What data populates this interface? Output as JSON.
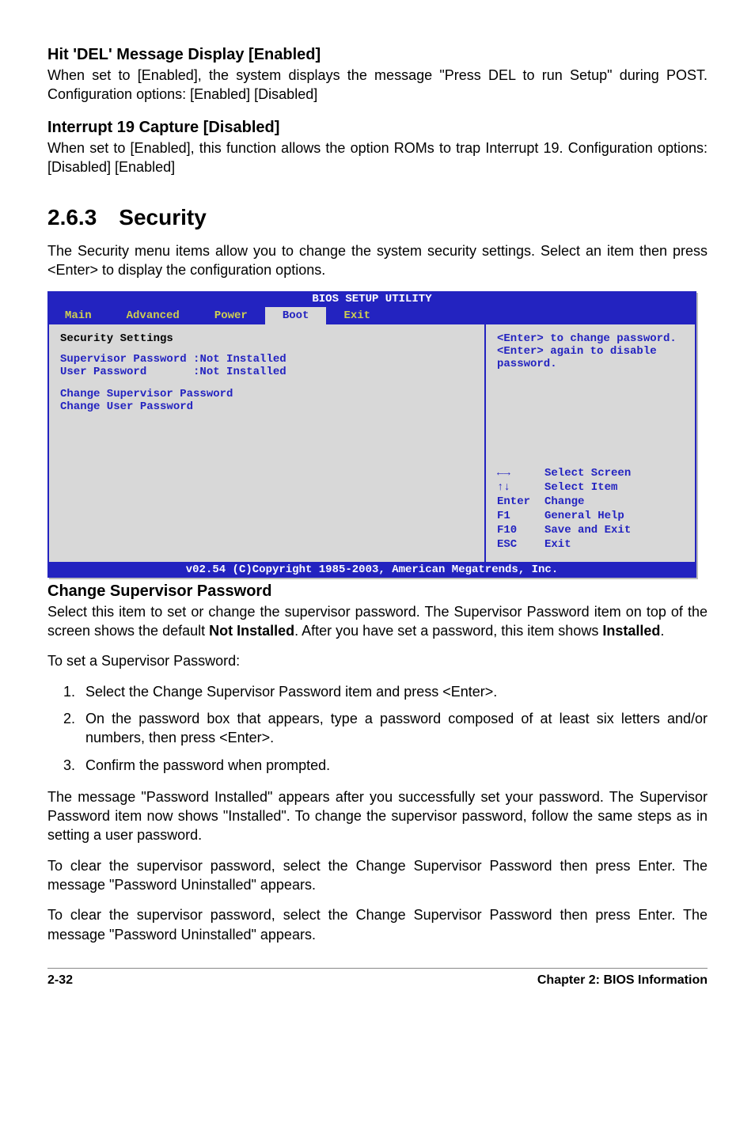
{
  "sections": {
    "hitdel": {
      "title": "Hit 'DEL' Message Display [Enabled]",
      "body": "When set to [Enabled], the system displays the message \"Press DEL to run Setup\" during POST. Configuration options: [Enabled] [Disabled]"
    },
    "int19": {
      "title": "Interrupt 19 Capture [Disabled]",
      "body": "When set to [Enabled], this function allows the option ROMs to trap Interrupt 19. Configuration options: [Disabled] [Enabled]"
    },
    "security": {
      "number_title": "2.6.3 Security",
      "intro": "The Security menu items allow you to change the system security settings. Select an item then press <Enter> to display the configuration options."
    },
    "csp": {
      "title": "Change Supervisor Password",
      "body_pre": "Select this item to set or change the supervisor password. The Supervisor Password item on top of the screen shows the default ",
      "not_installed": "Not Installed",
      "body_mid": ". After you have set a password, this item shows ",
      "installed": "Installed",
      "body_post": ".",
      "setline": "To set a Supervisor Password:",
      "steps": [
        "Select the Change Supervisor Password item and press <Enter>.",
        "On the password box that appears, type a password composed of at least six letters and/or numbers, then press <Enter>.",
        "Confirm the password when prompted."
      ],
      "p1": "The message \"Password Installed\" appears after you successfully set your password. The Supervisor Password item now shows \"Installed\". To change the supervisor password, follow the same steps as in setting a user password.",
      "p2": "To clear the supervisor password, select the Change Supervisor Password then press Enter. The message \"Password Uninstalled\" appears.",
      "p3": "To clear the supervisor password, select the Change Supervisor Password then press Enter. The message \"Password Uninstalled\" appears."
    }
  },
  "bios": {
    "title": "BIOS SETUP UTILITY",
    "tabs": [
      "Main",
      "Advanced",
      "Power",
      "Boot",
      "Exit"
    ],
    "left": {
      "heading": "Security Settings",
      "row1_label": "Supervisor Password",
      "row1_val": ":Not Installed",
      "row2_label": "User Password",
      "row2_val": ":Not Installed",
      "opt1": "Change Supervisor Password",
      "opt2": "Change User Password"
    },
    "right": {
      "help1": "<Enter> to change password.",
      "help2": "<Enter> again to disable password.",
      "nav": [
        {
          "k": "←→",
          "v": "Select Screen"
        },
        {
          "k": "↑↓",
          "v": "Select Item"
        },
        {
          "k": "Enter",
          "v": "Change"
        },
        {
          "k": "F1",
          "v": "General Help"
        },
        {
          "k": "F10",
          "v": "Save and Exit"
        },
        {
          "k": "ESC",
          "v": "Exit"
        }
      ]
    },
    "footer": "v02.54 (C)Copyright 1985-2003, American Megatrends, Inc."
  },
  "pagefoot": {
    "left": "2-32",
    "right": "Chapter 2: BIOS Information"
  }
}
